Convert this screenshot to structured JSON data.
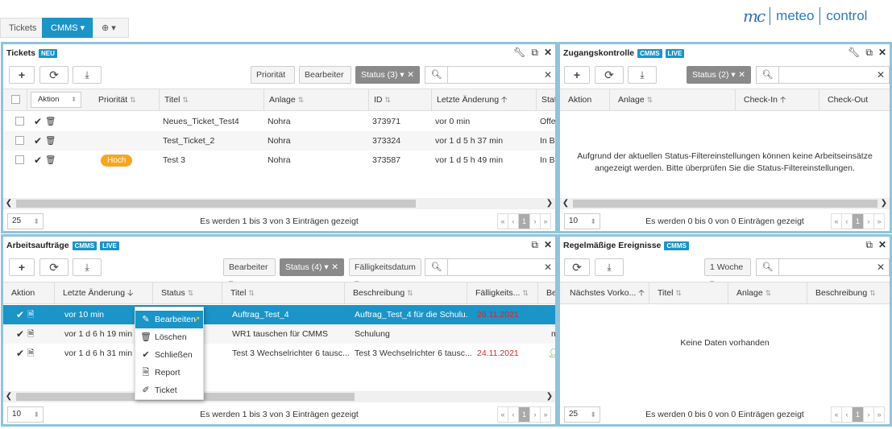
{
  "tabs": {
    "tickets": "Tickets",
    "cmms": "CMMS ▾",
    "add": "⊕ ▾"
  },
  "logo": {
    "mark": "mc",
    "left": "meteo",
    "right": "control"
  },
  "tickets": {
    "title": "Tickets",
    "badge": "NEU",
    "priority_dd": "Priorität ▾",
    "editor_dd": "Bearbeiter ▾",
    "status_dd": "Status (3) ▾",
    "action_select": "Aktion",
    "columns": [
      "Priorität",
      "Titel",
      "Anlage",
      "ID",
      "Letzte Änderung",
      "Statu"
    ],
    "rows": [
      {
        "priority": "",
        "title": "Neues_Ticket_Test4",
        "plant": "Nohra",
        "id": "373971",
        "changed": "vor 0 min",
        "status": "Offer"
      },
      {
        "priority": "",
        "title": "Test_Ticket_2",
        "plant": "Nohra",
        "id": "373324",
        "changed": "vor 1 d 5 h 37 min",
        "status": "In Be"
      },
      {
        "priority": "Hoch",
        "title": "Test 3",
        "plant": "Nohra",
        "id": "373587",
        "changed": "vor 1 d 5 h 49 min",
        "status": "In Be"
      }
    ],
    "page_size": "25",
    "info": "Es werden 1 bis 3 von 3 Einträgen gezeigt",
    "page": "1"
  },
  "access": {
    "title": "Zugangskontrolle",
    "badge1": "CMMS",
    "badge2": "LIVE",
    "status_dd": "Status (2) ▾",
    "columns": [
      "Aktion",
      "Anlage",
      "Check-In",
      "Check-Out"
    ],
    "empty": "Aufgrund der aktuellen Status-Filtereinstellungen können keine Arbeitseinsätze angezeigt werden. Bitte überprüfen Sie die Status-Filtereinstellungen.",
    "page_size": "10",
    "info": "Es werden 0 bis 0 von 0 Einträgen gezeigt",
    "page": "1"
  },
  "workorders": {
    "title": "Arbeitsaufträge",
    "badge1": "CMMS",
    "badge2": "LIVE",
    "editor_dd": "Bearbeiter ▾",
    "status_dd": "Status (4) ▾",
    "due_dd": "Fälligkeitsdatum ▾",
    "columns": [
      "Aktion",
      "Letzte Änderung",
      "Status",
      "Titel",
      "Beschreibung",
      "Fälligkeits...",
      "Be"
    ],
    "rows": [
      {
        "changed": "vor 10 min",
        "title": "Auftrag_Test_4",
        "desc": "Auftrag_Test_4 für die Schulu...",
        "due": "26.11.2021",
        "extra": ""
      },
      {
        "changed": "vor 1 d 6 h 19 min",
        "title": "WR1 tauschen für CMMS",
        "desc": "Schulung",
        "due": "",
        "extra": "m"
      },
      {
        "changed": "vor 1 d 6 h 31 min",
        "title": "Test 3 Wechselrichter 6 tausc...",
        "desc": "Test 3 Wechselrichter 6 tausc...",
        "due": "24.11.2021",
        "extra": ""
      }
    ],
    "menu": [
      "Bearbeiten",
      "Löschen",
      "Schließen",
      "Report",
      "Ticket"
    ],
    "page_size": "10",
    "info": "Es werden 1 bis 3 von 3 Einträgen gezeigt",
    "page": "1"
  },
  "events": {
    "title": "Regelmäßige Ereignisse",
    "badge": "CMMS",
    "interval_dd": "1 Woche ▾",
    "columns": [
      "Nächstes Vorko...",
      "Titel",
      "Anlage",
      "Beschreibung"
    ],
    "empty": "Keine Daten vorhanden",
    "page_size": "25",
    "info": "Es werden 0 bis 0 von 0 Einträgen gezeigt",
    "page": "1"
  },
  "colors": {
    "accent": "#1b94c8",
    "border": "#8fc4dc",
    "priority_high": "#f5a623",
    "due_red": "#d9262c"
  }
}
